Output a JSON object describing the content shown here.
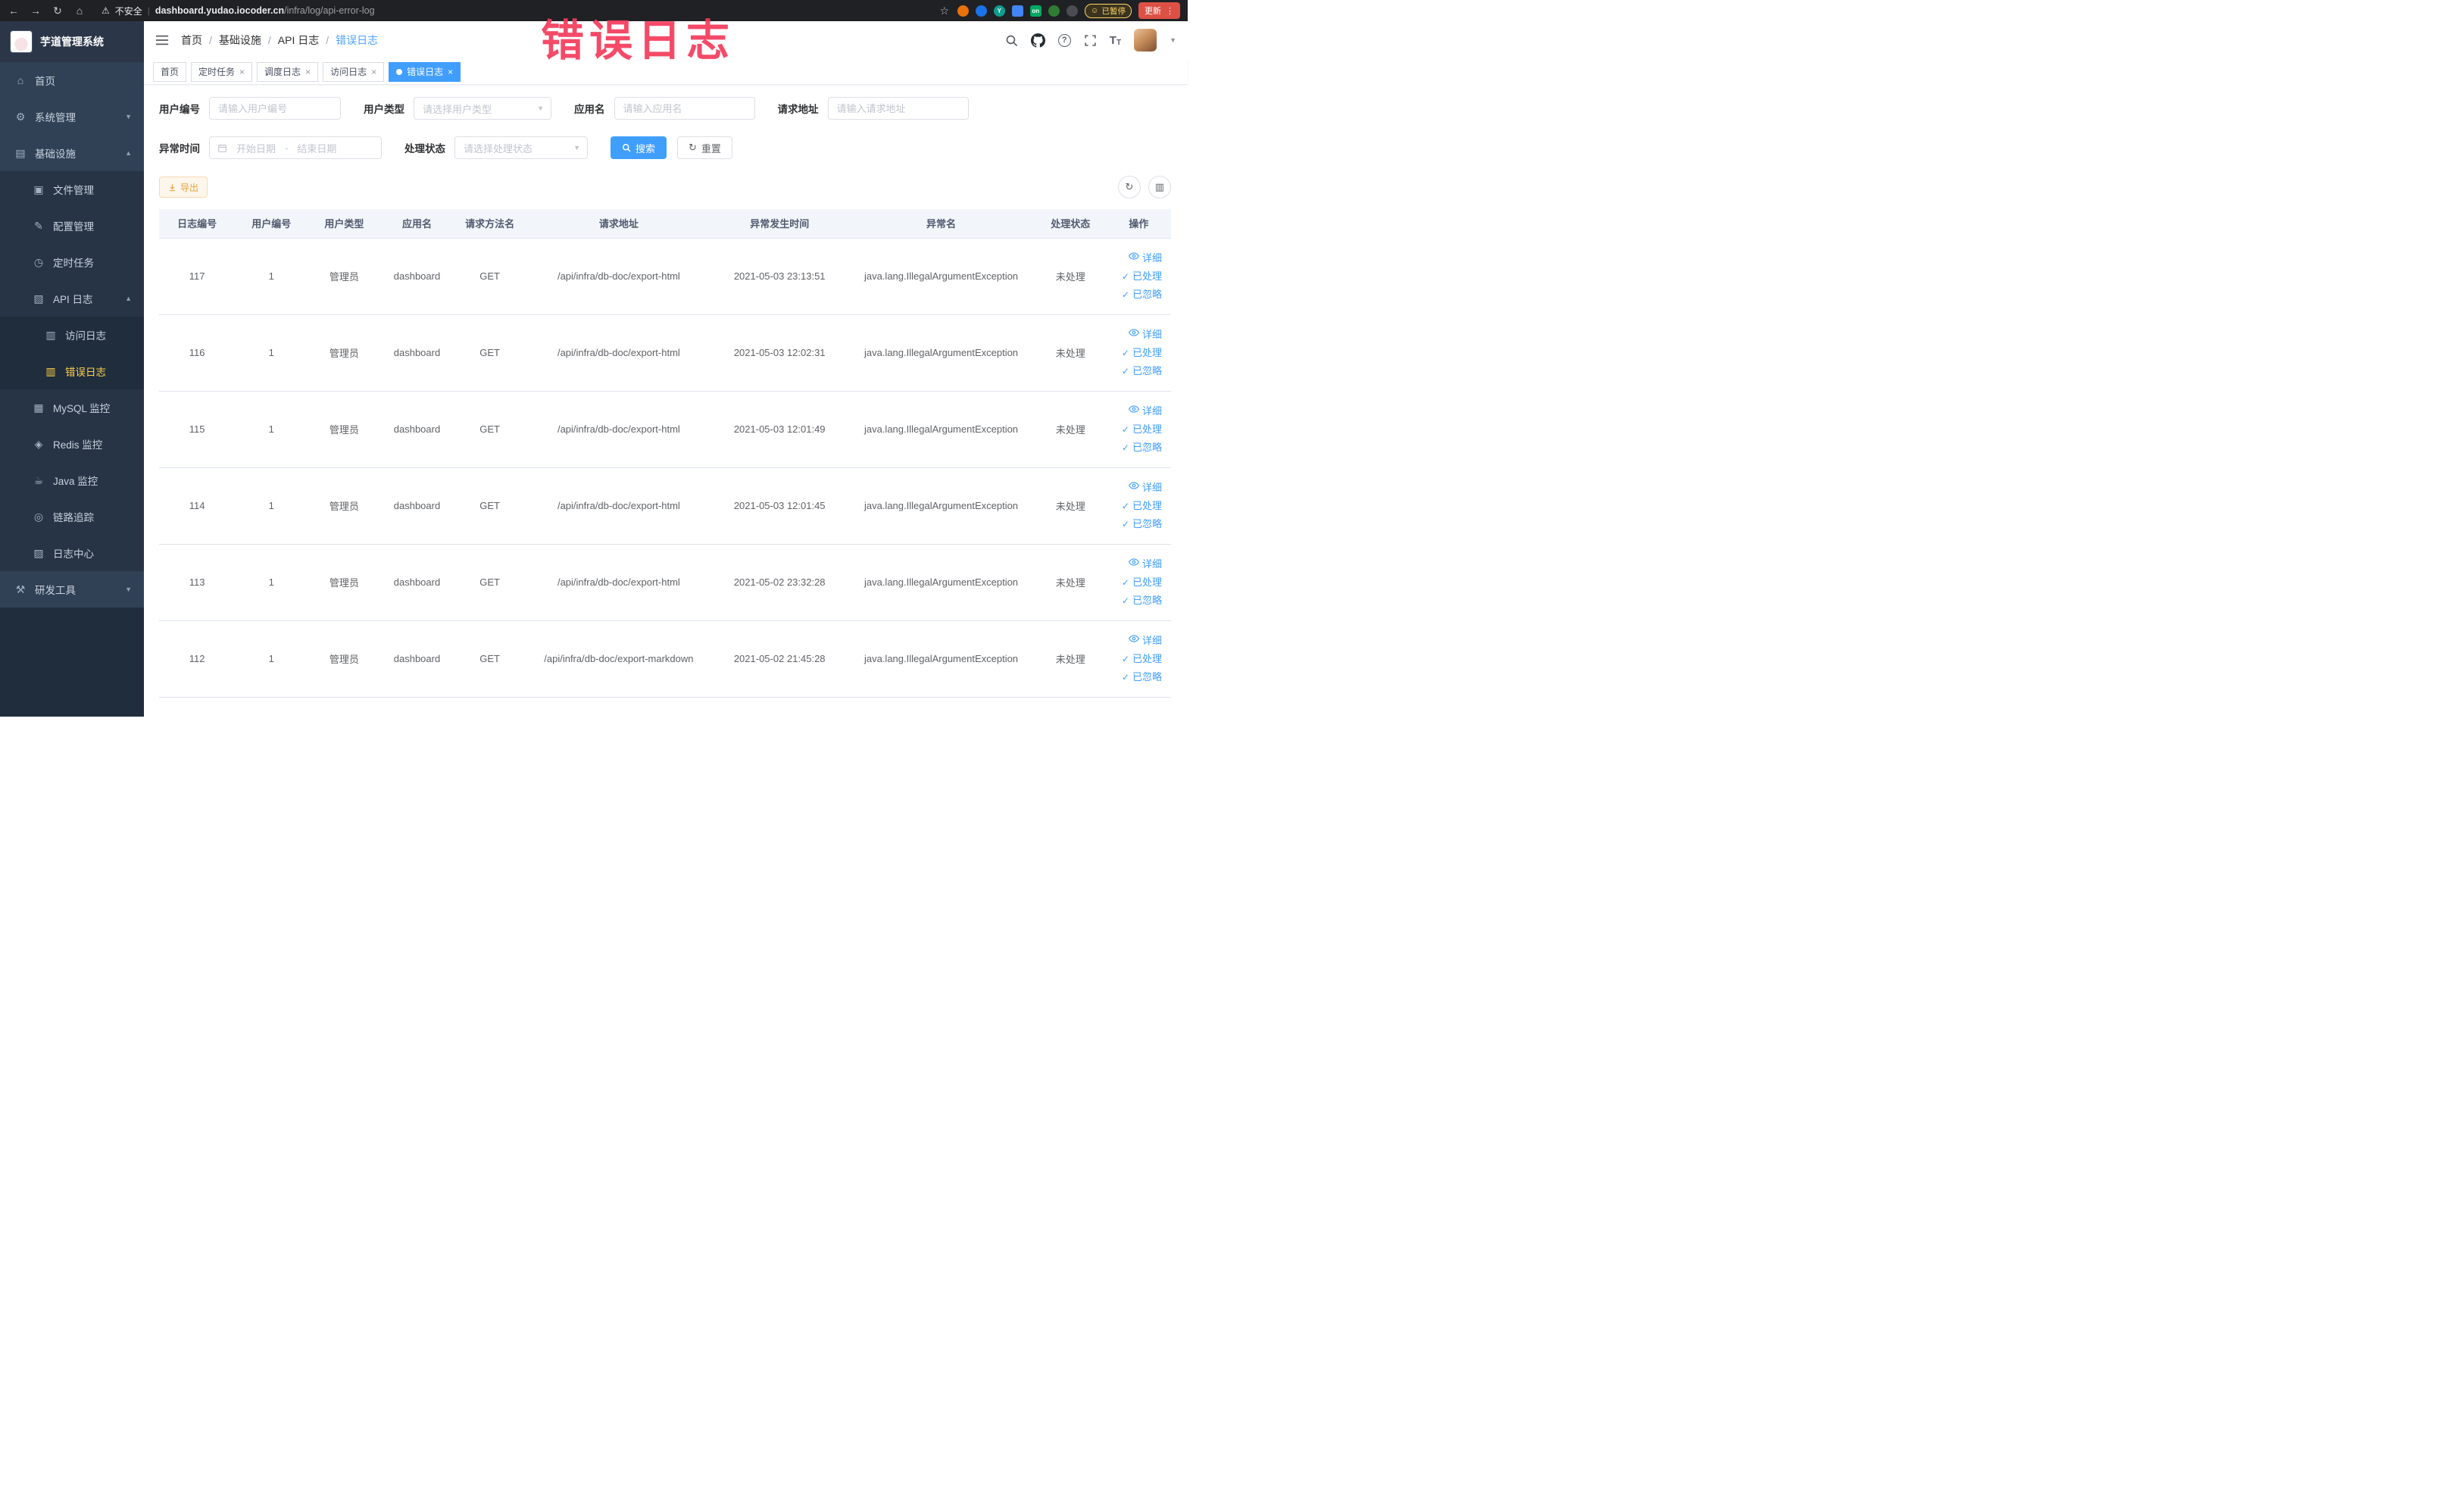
{
  "annotation": {
    "text": "错误日志"
  },
  "browser": {
    "security_label": "不安全",
    "url_domain": "dashboard.yudao.iocoder.cn",
    "url_path": "/infra/log/api-error-log",
    "ext_y": "Y",
    "ext_on": "on",
    "paused_badge": "已暂停",
    "update_button": "更新"
  },
  "sidebar": {
    "logo_title": "芋道管理系统",
    "menu": [
      {
        "key": "home",
        "label": "首页",
        "icon": "home-icon",
        "level": 1
      },
      {
        "key": "system",
        "label": "系统管理",
        "icon": "gear-icon",
        "level": 1,
        "arrow": "down"
      },
      {
        "key": "infra",
        "label": "基础设施",
        "icon": "infra-icon",
        "level": 1,
        "arrow": "up"
      },
      {
        "key": "file",
        "label": "文件管理",
        "icon": "file-icon",
        "level": 2
      },
      {
        "key": "config",
        "label": "配置管理",
        "icon": "config-icon",
        "level": 2
      },
      {
        "key": "job",
        "label": "定时任务",
        "icon": "job-icon",
        "level": 2
      },
      {
        "key": "api-log",
        "label": "API 日志",
        "icon": "api-log-icon",
        "level": 2,
        "arrow": "up"
      },
      {
        "key": "access-log",
        "label": "访问日志",
        "icon": "access-log-icon",
        "level": 3
      },
      {
        "key": "error-log",
        "label": "错误日志",
        "icon": "error-log-icon",
        "level": 3,
        "active": true
      },
      {
        "key": "mysql",
        "label": "MySQL 监控",
        "icon": "mysql-icon",
        "level": 2
      },
      {
        "key": "redis",
        "label": "Redis 监控",
        "icon": "redis-icon",
        "level": 2
      },
      {
        "key": "java",
        "label": "Java 监控",
        "icon": "java-icon",
        "level": 2
      },
      {
        "key": "trace",
        "label": "链路追踪",
        "icon": "trace-icon",
        "level": 2
      },
      {
        "key": "log-center",
        "label": "日志中心",
        "icon": "log-center-icon",
        "level": 2
      },
      {
        "key": "devtools",
        "label": "研发工具",
        "icon": "devtools-icon",
        "level": 1,
        "arrow": "down"
      }
    ]
  },
  "header": {
    "breadcrumb": [
      "首页",
      "基础设施",
      "API 日志",
      "错误日志"
    ]
  },
  "tabs": [
    {
      "label": "首页",
      "closable": false,
      "active": false
    },
    {
      "label": "定时任务",
      "closable": true,
      "active": false
    },
    {
      "label": "调度日志",
      "closable": true,
      "active": false
    },
    {
      "label": "访问日志",
      "closable": true,
      "active": false
    },
    {
      "label": "错误日志",
      "closable": true,
      "active": true
    }
  ],
  "filters": {
    "user_id": {
      "label": "用户编号",
      "placeholder": "请输入用户编号"
    },
    "user_type": {
      "label": "用户类型",
      "placeholder": "请选择用户类型"
    },
    "app_name": {
      "label": "应用名",
      "placeholder": "请输入应用名"
    },
    "request_url": {
      "label": "请求地址",
      "placeholder": "请输入请求地址"
    },
    "exception_time": {
      "label": "异常时间",
      "start_placeholder": "开始日期",
      "separator": "-",
      "end_placeholder": "结束日期"
    },
    "process_status": {
      "label": "处理状态",
      "placeholder": "请选择处理状态"
    },
    "search_button": "搜索",
    "reset_button": "重置"
  },
  "toolbar": {
    "export_button": "导出"
  },
  "table": {
    "columns": [
      "日志编号",
      "用户编号",
      "用户类型",
      "应用名",
      "请求方法名",
      "请求地址",
      "异常发生时间",
      "异常名",
      "处理状态",
      "操作"
    ],
    "actions": [
      "详细",
      "已处理",
      "已忽略"
    ],
    "rows": [
      {
        "id": "117",
        "user_id": "1",
        "user_type": "管理员",
        "app": "dashboard",
        "method": "GET",
        "url": "/api/infra/db-doc/export-html",
        "time": "2021-05-03 23:13:51",
        "exception": "java.lang.IllegalArgumentException",
        "status": "未处理"
      },
      {
        "id": "116",
        "user_id": "1",
        "user_type": "管理员",
        "app": "dashboard",
        "method": "GET",
        "url": "/api/infra/db-doc/export-html",
        "time": "2021-05-03 12:02:31",
        "exception": "java.lang.IllegalArgumentException",
        "status": "未处理"
      },
      {
        "id": "115",
        "user_id": "1",
        "user_type": "管理员",
        "app": "dashboard",
        "method": "GET",
        "url": "/api/infra/db-doc/export-html",
        "time": "2021-05-03 12:01:49",
        "exception": "java.lang.IllegalArgumentException",
        "status": "未处理"
      },
      {
        "id": "114",
        "user_id": "1",
        "user_type": "管理员",
        "app": "dashboard",
        "method": "GET",
        "url": "/api/infra/db-doc/export-html",
        "time": "2021-05-03 12:01:45",
        "exception": "java.lang.IllegalArgumentException",
        "status": "未处理"
      },
      {
        "id": "113",
        "user_id": "1",
        "user_type": "管理员",
        "app": "dashboard",
        "method": "GET",
        "url": "/api/infra/db-doc/export-html",
        "time": "2021-05-02 23:32:28",
        "exception": "java.lang.IllegalArgumentException",
        "status": "未处理"
      },
      {
        "id": "112",
        "user_id": "1",
        "user_type": "管理员",
        "app": "dashboard",
        "method": "GET",
        "url": "/api/infra/db-doc/export-markdown",
        "time": "2021-05-02 21:45:28",
        "exception": "java.lang.IllegalArgumentException",
        "status": "未处理"
      }
    ]
  }
}
